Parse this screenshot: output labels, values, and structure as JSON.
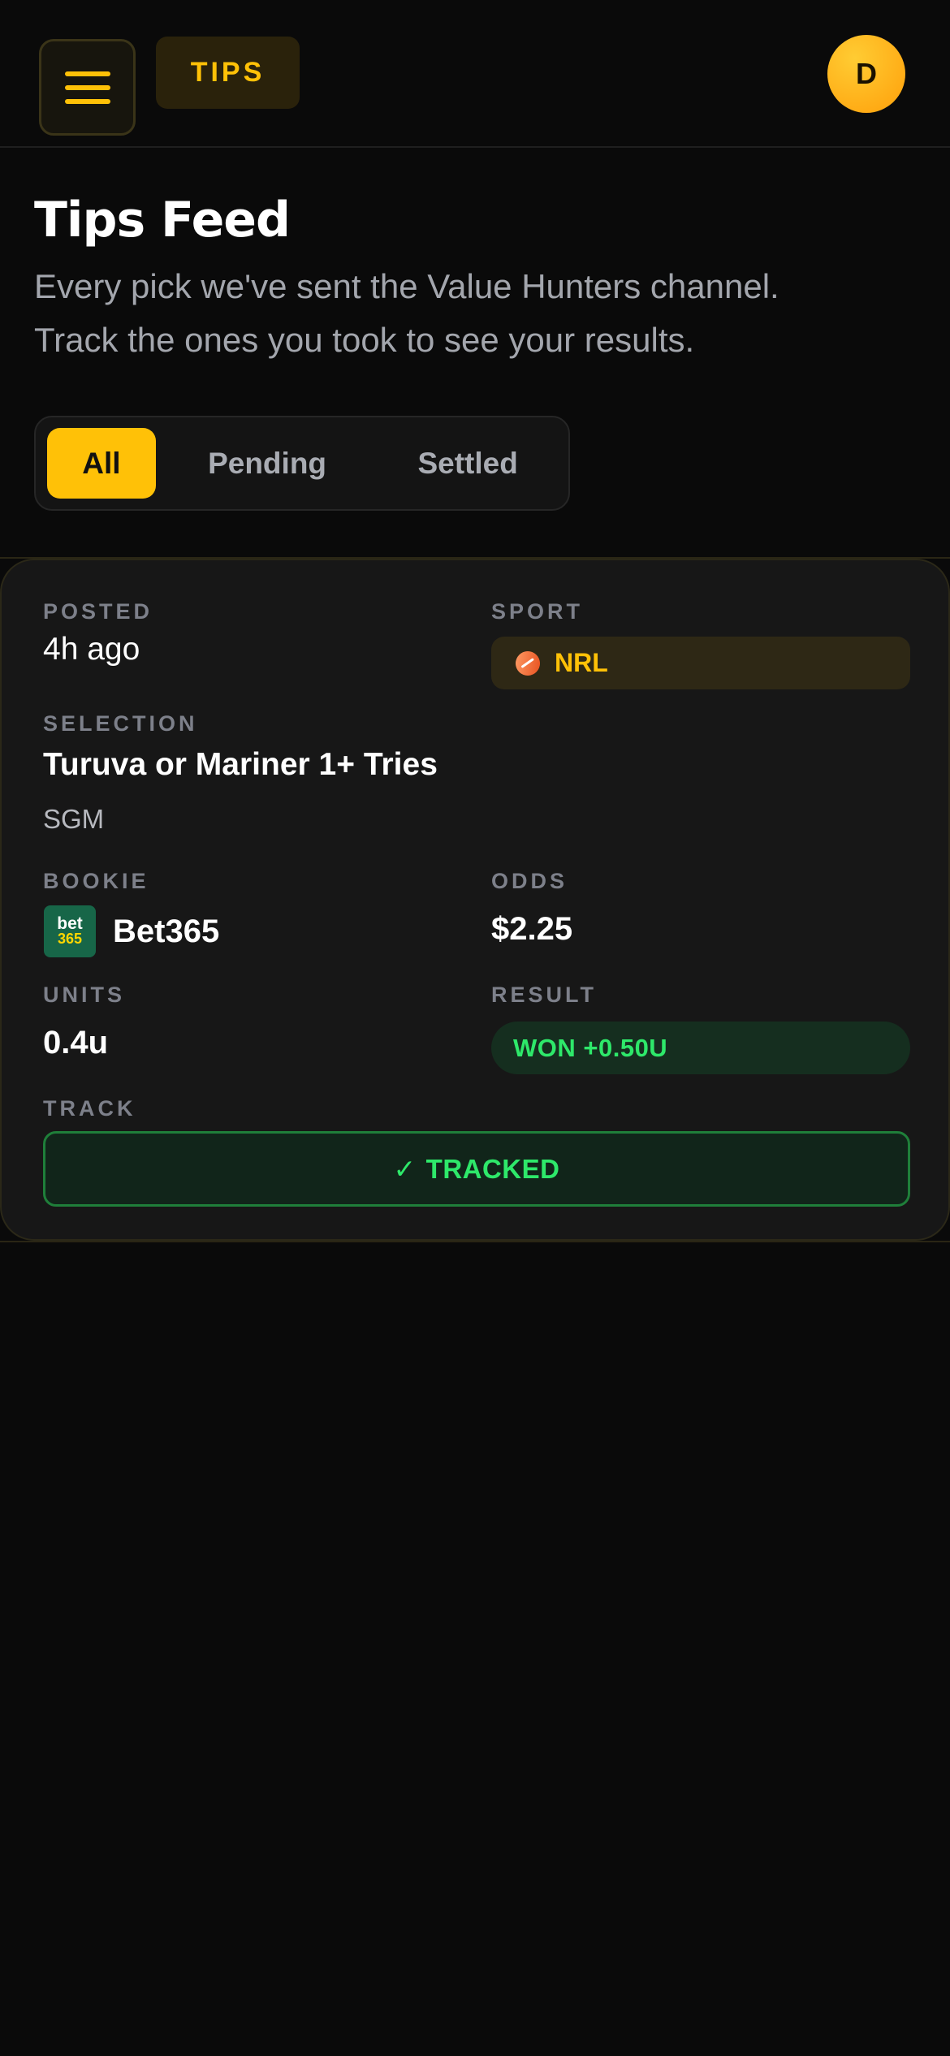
{
  "header": {
    "tips_label": "TIPS",
    "avatar_initial": "D"
  },
  "page": {
    "title": "Tips Feed",
    "subtitle_line1": "Every pick we've sent the Value Hunters channel.",
    "subtitle_line2": "Track the ones you took to see your results."
  },
  "filters": {
    "all": "All",
    "pending": "Pending",
    "settled": "Settled",
    "selected": "All"
  },
  "tip": {
    "posted_label": "POSTED",
    "posted_value": "4h ago",
    "sport_label": "SPORT",
    "sport_value": "NRL",
    "sport_icon": "rugby-ball-icon",
    "selection_label": "SELECTION",
    "selection_value": "Turuva or Mariner 1+ Tries",
    "selection_type": "SGM",
    "bookie_label": "BOOKIE",
    "bookie_logo_top": "bet",
    "bookie_logo_bottom": "365",
    "bookie_value": "Bet365",
    "odds_label": "ODDS",
    "odds_value": "$2.25",
    "units_label": "UNITS",
    "units_value": "0.4u",
    "result_label": "RESULT",
    "result_value": "WON +0.50U",
    "track_label": "TRACK",
    "track_check": "✓",
    "track_value": "TRACKED"
  },
  "colors": {
    "accent": "#ffc107",
    "background": "#0a0a0a",
    "card": "#171717",
    "success": "#2ee86a"
  }
}
